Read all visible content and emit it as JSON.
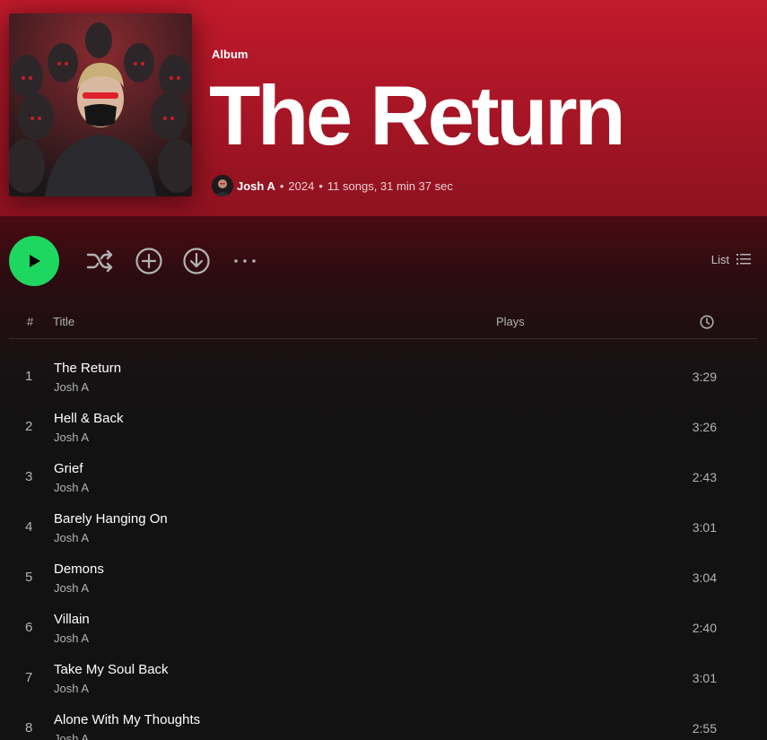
{
  "album": {
    "type_label": "Album",
    "title": "The Return",
    "artist": "Josh A",
    "year": "2024",
    "summary": "11 songs, 31 min 37 sec",
    "cover_icon": "album-cover-art"
  },
  "controls": {
    "play": "play-icon",
    "shuffle": "shuffle-icon",
    "add": "add-circle-icon",
    "download": "download-icon",
    "more": "more-icon",
    "view_label": "List"
  },
  "table": {
    "headers": {
      "num": "#",
      "title": "Title",
      "plays": "Plays",
      "duration": "clock-icon"
    },
    "tracks": [
      {
        "num": "1",
        "title": "The Return",
        "artist": "Josh A",
        "duration": "3:29"
      },
      {
        "num": "2",
        "title": "Hell & Back",
        "artist": "Josh A",
        "duration": "3:26"
      },
      {
        "num": "3",
        "title": "Grief",
        "artist": "Josh A",
        "duration": "2:43"
      },
      {
        "num": "4",
        "title": "Barely Hanging On",
        "artist": "Josh A",
        "duration": "3:01"
      },
      {
        "num": "5",
        "title": "Demons",
        "artist": "Josh A",
        "duration": "3:04"
      },
      {
        "num": "6",
        "title": "Villain",
        "artist": "Josh A",
        "duration": "2:40"
      },
      {
        "num": "7",
        "title": "Take My Soul Back",
        "artist": "Josh A",
        "duration": "3:01"
      },
      {
        "num": "8",
        "title": "Alone With My Thoughts",
        "artist": "Josh A",
        "duration": "2:55"
      }
    ]
  },
  "colors": {
    "header_red": "#b81829",
    "accent_green": "#1ed760",
    "background": "#121212"
  }
}
